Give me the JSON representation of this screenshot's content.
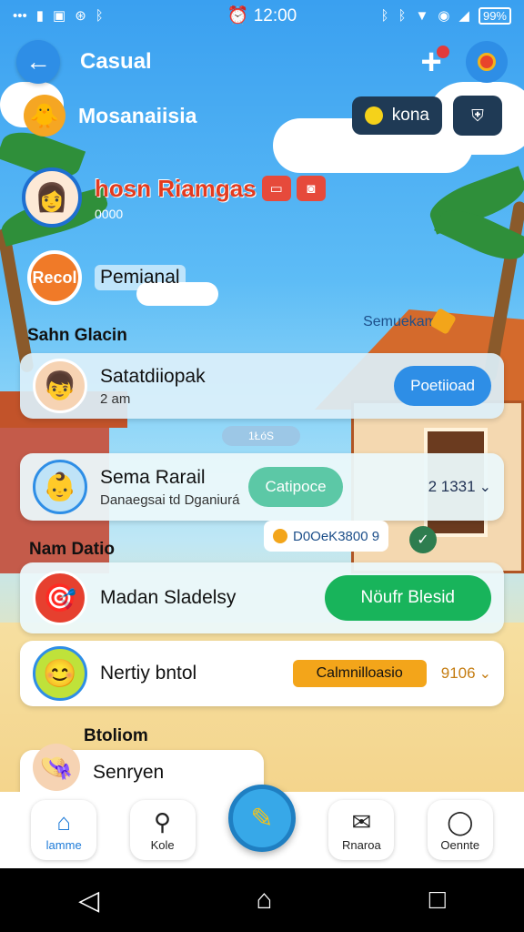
{
  "status_bar": {
    "time": "12:00",
    "battery": "99%"
  },
  "header": {
    "title": "Casual"
  },
  "section_user": {
    "label": "Mosanaiisia",
    "coins_label": "kona"
  },
  "profile": {
    "name": "hosn Riamgas",
    "subtitle": "0000"
  },
  "perm": {
    "badge": "Recol",
    "label": "Pemianal"
  },
  "section_labels": {
    "s1": "Sahn Glacin",
    "side_note": "Semuekam",
    "s2": "Nam Datio",
    "s3": "Btoliom"
  },
  "cards": [
    {
      "name": "Satatdiiopak",
      "sub": "2 am",
      "button": "Poetiioad"
    },
    {
      "name": "Sema Rarail",
      "sub": "Danaegsai td Dganiurá",
      "button": "Catipoce",
      "value": "2 1331"
    },
    {
      "name": "Madan Sladelsy",
      "button": "Nöufr Blesid"
    },
    {
      "name": "Nertiy bntol",
      "button": "Calmnilloasio",
      "value": "9106"
    },
    {
      "name": "Senryen"
    }
  ],
  "small_pill": "1ŁóS",
  "promo": "D0OeK3800 9",
  "bottom_nav": [
    {
      "label": "lamme",
      "icon": "home-icon"
    },
    {
      "label": "Kole",
      "icon": "search-icon"
    },
    {
      "label": "Rnaroa",
      "icon": "mail-icon"
    },
    {
      "label": "Oennte",
      "icon": "chat-icon"
    }
  ],
  "colors": {
    "accent": "#2e8ee6",
    "green": "#18b45b",
    "orange": "#f3a51a",
    "name_red": "#e23b20"
  }
}
